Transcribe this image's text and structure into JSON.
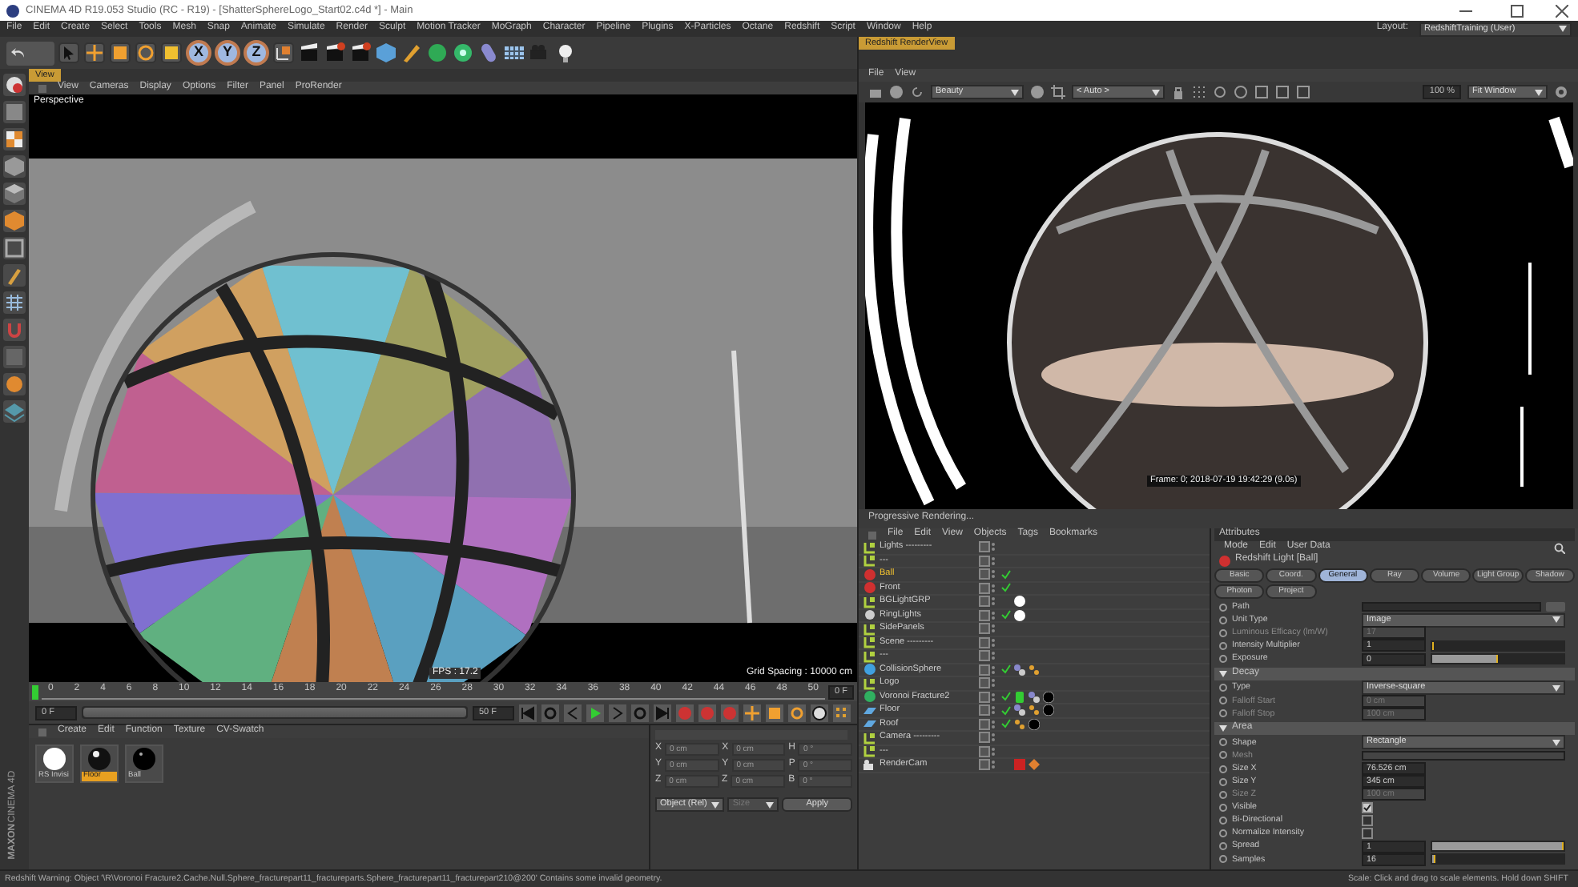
{
  "window": {
    "title": "CINEMA 4D R19.053 Studio (RC - R19) - [ShatterSphereLogo_Start02.c4d *] - Main"
  },
  "menu_bar": [
    "File",
    "Edit",
    "Create",
    "Select",
    "Tools",
    "Mesh",
    "Snap",
    "Animate",
    "Simulate",
    "Render",
    "Sculpt",
    "Motion Tracker",
    "MoGraph",
    "Character",
    "Pipeline",
    "Plugins",
    "X-Particles",
    "Octane",
    "Redshift",
    "Script",
    "Window",
    "Help"
  ],
  "layout": {
    "label": "Layout:",
    "value": "RedshiftTraining (User)"
  },
  "toolbar": {
    "axis_buttons": [
      "X",
      "Y",
      "Z"
    ]
  },
  "branding": {
    "company": "MAXON",
    "product": "CINEMA 4D"
  },
  "viewport": {
    "tab": "View",
    "menu": [
      "View",
      "Cameras",
      "Display",
      "Options",
      "Filter",
      "Panel",
      "ProRender"
    ],
    "camera": "Perspective",
    "fps": "FPS : 17.2",
    "grid_spacing": "Grid Spacing : 10000 cm"
  },
  "timeline": {
    "range": {
      "level": 1
    },
    "ticks": [
      "0",
      "2",
      "4",
      "6",
      "8",
      "10",
      "12",
      "14",
      "16",
      "18",
      "20",
      "22",
      "24",
      "26",
      "28",
      "30",
      "32",
      "34",
      "36",
      "38",
      "40",
      "42",
      "44",
      "46",
      "48",
      "50"
    ],
    "current": "0 F",
    "start": "0 F",
    "end": "50 F"
  },
  "material_manager": {
    "menu": [
      "Create",
      "Edit",
      "Function",
      "Texture",
      "CV-Swatch"
    ],
    "materials": [
      {
        "name": "RS Invisi",
        "kind": "white",
        "selected": false
      },
      {
        "name": "Floor",
        "kind": "glossy",
        "selected": true
      },
      {
        "name": "Ball",
        "kind": "dark",
        "selected": false
      }
    ]
  },
  "coordinates": {
    "rows": [
      {
        "axis": "X",
        "position": "0 cm",
        "size_axis": "X",
        "size": "0 cm",
        "rot_axis": "H",
        "rotation": "0 °"
      },
      {
        "axis": "Y",
        "position": "0 cm",
        "size_axis": "Y",
        "size": "0 cm",
        "rot_axis": "P",
        "rotation": "0 °"
      },
      {
        "axis": "Z",
        "position": "0 cm",
        "size_axis": "Z",
        "size": "0 cm",
        "rot_axis": "B",
        "rotation": "0 °"
      }
    ],
    "mode": "Object (Rel)",
    "size_mode": "Size",
    "apply": "Apply"
  },
  "render_view": {
    "tab": "Redshift RenderView",
    "menu": [
      "File",
      "View"
    ],
    "pass": "Beauty",
    "camera": "< Auto >",
    "zoom": "100 %",
    "fit": "Fit Window",
    "frame_info": "Frame: 0; 2018-07-19 19:42:29 (9.0s)",
    "status": "Progressive Rendering..."
  },
  "object_manager": {
    "menu": [
      "File",
      "Edit",
      "View",
      "Objects",
      "Tags",
      "Bookmarks"
    ],
    "objects": [
      {
        "name": "Lights ---------",
        "kind": "null",
        "selected": false,
        "enabled": false
      },
      {
        "name": "---",
        "kind": "null",
        "selected": false,
        "enabled": false
      },
      {
        "name": "Ball",
        "kind": "light",
        "selected": true,
        "enabled": true
      },
      {
        "name": "Front",
        "kind": "light",
        "selected": false,
        "enabled": true
      },
      {
        "name": "BGLightGRP",
        "kind": "null",
        "selected": false,
        "enabled": false,
        "tags": [
          {
            "kind": "ball"
          }
        ]
      },
      {
        "name": "RingLights",
        "kind": "gear",
        "selected": false,
        "enabled": true,
        "tags": [
          {
            "kind": "ball"
          }
        ]
      },
      {
        "name": "SidePanels",
        "kind": "null",
        "selected": false,
        "enabled": false
      },
      {
        "name": "Scene ---------",
        "kind": "null",
        "selected": false,
        "enabled": false
      },
      {
        "name": "---",
        "kind": "null",
        "selected": false,
        "enabled": false
      },
      {
        "name": "CollisionSphere",
        "kind": "sphere",
        "selected": false,
        "enabled": true,
        "tags": [
          {
            "kind": "phong"
          },
          {
            "kind": "texture"
          }
        ]
      },
      {
        "name": "Logo",
        "kind": "null",
        "selected": false,
        "enabled": false
      },
      {
        "name": "Voronoi Fracture2",
        "kind": "fracture",
        "selected": false,
        "enabled": true,
        "tags": [
          {
            "kind": "battery"
          },
          {
            "kind": "phong"
          },
          {
            "kind": "material"
          }
        ]
      },
      {
        "name": "Floor",
        "kind": "floor",
        "selected": false,
        "enabled": true,
        "tags": [
          {
            "kind": "phong"
          },
          {
            "kind": "texture"
          },
          {
            "kind": "material"
          }
        ]
      },
      {
        "name": "Roof",
        "kind": "floor",
        "selected": false,
        "enabled": true,
        "tags": [
          {
            "kind": "texture"
          },
          {
            "kind": "material"
          }
        ]
      },
      {
        "name": "Camera ---------",
        "kind": "null",
        "selected": false,
        "enabled": false
      },
      {
        "name": "---",
        "kind": "null",
        "selected": false,
        "enabled": false
      },
      {
        "name": "RenderCam",
        "kind": "camera",
        "selected": false,
        "enabled": false,
        "tags": [
          {
            "kind": "render"
          },
          {
            "kind": "target"
          }
        ]
      }
    ]
  },
  "attributes": {
    "title": "Attributes",
    "menu": [
      "Mode",
      "Edit",
      "User Data"
    ],
    "object": "Redshift Light [Ball]",
    "tabs": [
      {
        "label": "Basic",
        "selected": false
      },
      {
        "label": "Coord.",
        "selected": false
      },
      {
        "label": "General",
        "selected": true
      },
      {
        "label": "Ray",
        "selected": false
      },
      {
        "label": "Volume",
        "selected": false
      },
      {
        "label": "Light Group",
        "selected": false
      },
      {
        "label": "Shadow",
        "selected": false
      },
      {
        "label": "Photon",
        "selected": false
      },
      {
        "label": "Project",
        "selected": false
      }
    ],
    "rows": [
      {
        "kind": "path",
        "label": "Path"
      },
      {
        "kind": "dropdown",
        "label": "Unit Type",
        "value": "Image",
        "disabled": false
      },
      {
        "kind": "number",
        "label": "Luminous Efficacy (lm/W)",
        "value": "17",
        "disabled": true
      },
      {
        "kind": "slider",
        "label": "Intensity Multiplier",
        "value": "1",
        "level": 0
      },
      {
        "kind": "slider",
        "label": "Exposure",
        "value": "0",
        "level": 0.5
      },
      {
        "kind": "section",
        "label": "Decay"
      },
      {
        "kind": "dropdown",
        "label": "Type",
        "value": "Inverse-square",
        "disabled": false
      },
      {
        "kind": "number",
        "label": "Falloff Start",
        "value": "0 cm",
        "disabled": true
      },
      {
        "kind": "number",
        "label": "Falloff Stop",
        "value": "100 cm",
        "disabled": true
      },
      {
        "kind": "section",
        "label": "Area"
      },
      {
        "kind": "dropdown",
        "label": "Shape",
        "value": "Rectangle",
        "disabled": false
      },
      {
        "kind": "link",
        "label": "Mesh",
        "disabled": true
      },
      {
        "kind": "number",
        "label": "Size X",
        "value": "76.526 cm",
        "disabled": false
      },
      {
        "kind": "number",
        "label": "Size Y",
        "value": "345 cm",
        "disabled": false
      },
      {
        "kind": "number",
        "label": "Size Z",
        "value": "100 cm",
        "disabled": true
      },
      {
        "kind": "checkbox",
        "label": "Visible",
        "checked": true
      },
      {
        "kind": "checkbox",
        "label": "Bi-Directional",
        "checked": false
      },
      {
        "kind": "checkbox",
        "label": "Normalize Intensity",
        "checked": false
      },
      {
        "kind": "slider",
        "label": "Spread",
        "value": "1",
        "level": 1
      },
      {
        "kind": "slider",
        "label": "Samples",
        "value": "16",
        "level": 0.02
      }
    ]
  },
  "status_bar": {
    "message": "Redshift Warning: Object '\\R\\Voronoi Fracture2.Cache.Null.Sphere_fracturepart11_fractureparts.Sphere_fracturepart11_fracturepart210@200' Contains some invalid geometry.",
    "hint": "Scale: Click and drag to scale elements. Hold down SHIFT"
  }
}
